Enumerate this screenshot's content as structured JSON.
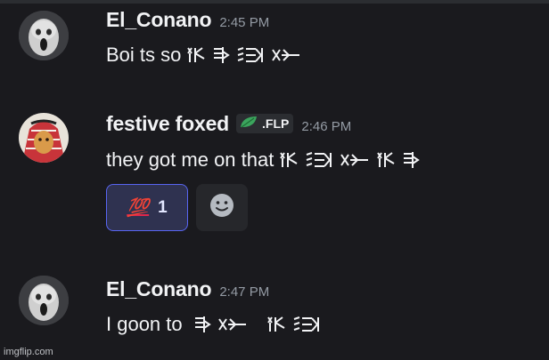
{
  "messages": [
    {
      "username": "El_Conano",
      "timestamp": "2:45 PM",
      "text": "Boi ts so",
      "glyphs": [
        "glyph-a",
        "glyph-b",
        "glyph-c",
        "glyph-d"
      ]
    },
    {
      "username": "festive foxed",
      "tag": {
        "icon": "leaf-icon",
        "text": ".FLP"
      },
      "timestamp": "2:46 PM",
      "text": "they got me on that",
      "glyphs": [
        "glyph-a",
        "glyph-c",
        "glyph-d",
        "glyph-a",
        "glyph-b"
      ],
      "reactions": [
        {
          "emoji": "💯",
          "count": "1"
        }
      ],
      "add_reaction_icon": "smiley-icon"
    },
    {
      "username": "El_Conano",
      "timestamp": "2:47 PM",
      "text": "I goon to",
      "glyphs": [
        "glyph-b",
        "glyph-d",
        "glyph-a",
        "glyph-c"
      ]
    }
  ],
  "watermark": "imgflip.com",
  "colors": {
    "background": "#1a1a1e",
    "reaction_border": "#5865f2",
    "leaf": "#3ba55d"
  }
}
